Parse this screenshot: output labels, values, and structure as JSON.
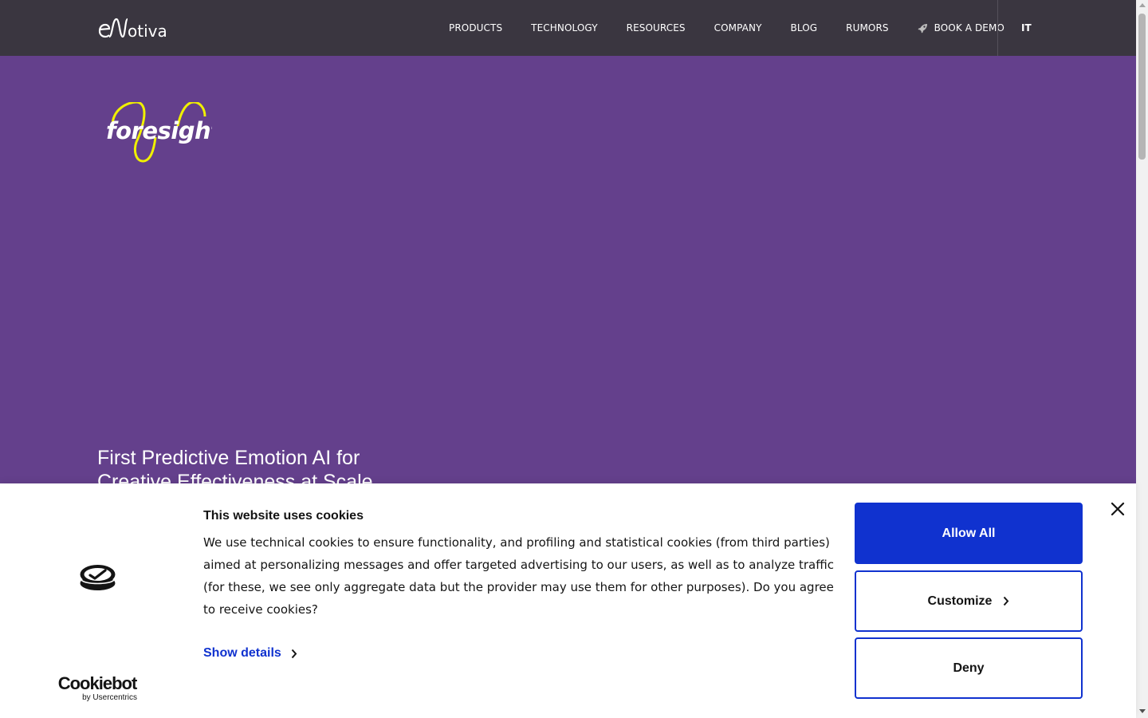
{
  "header": {
    "logo_text": "eMotiva",
    "nav": [
      {
        "label": "PRODUCTS"
      },
      {
        "label": "TECHNOLOGY"
      },
      {
        "label": "RESOURCES"
      },
      {
        "label": "COMPANY"
      },
      {
        "label": "BLOG"
      },
      {
        "label": "RUMORS"
      },
      {
        "label": "BOOK A DEMO",
        "icon": "rocket-icon"
      }
    ],
    "language": "IT"
  },
  "hero": {
    "product_logo_text": "foresight",
    "title": "First Predictive Emotion AI for Creative Effectiveness at Scale",
    "background_color": "#64408c",
    "accent_color": "#f0f000"
  },
  "cookie_banner": {
    "title": "This website uses cookies",
    "text": "We use technical cookies to ensure functionality, and profiling and statistical cookies (from third parties) aimed at personalizing messages and offer targeted advertising to our users, as well as to analyze traffic (for these, we see only aggregate data but the provider may use them for other purposes). Do you agree to receive cookies?",
    "show_details": "Show details",
    "allow_all": "Allow All",
    "customize": "Customize",
    "deny": "Deny",
    "brand_main": "Cookiebot",
    "brand_sub": "by Usercentrics",
    "accent_color": "#1032cf"
  }
}
